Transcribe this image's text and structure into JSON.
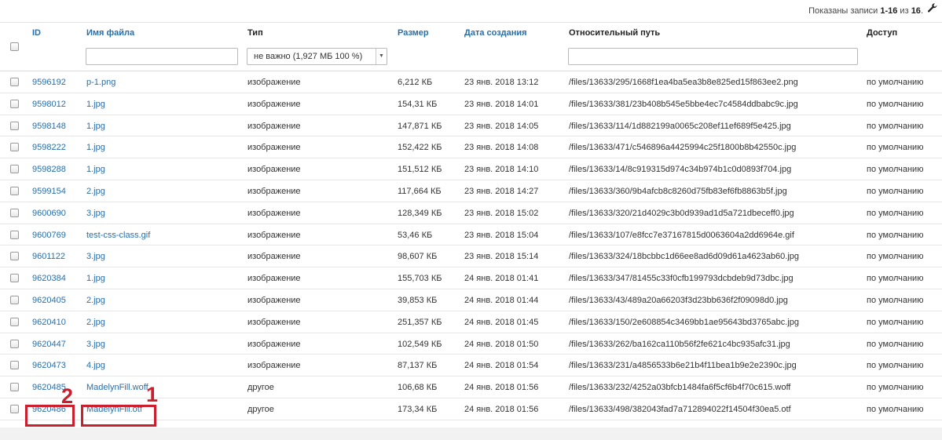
{
  "header": {
    "records_prefix": "Показаны записи ",
    "records_range": "1-16",
    "records_middle": " из ",
    "records_total": "16",
    "records_suffix": ".",
    "settings_icon": "wrench-icon"
  },
  "columns": {
    "id": "ID",
    "filename": "Имя файла",
    "type": "Тип",
    "size": "Размер",
    "created": "Дата создания",
    "path": "Относительный путь",
    "access": "Доступ"
  },
  "filters": {
    "filename_value": "",
    "type_selected": "не важно (1,927 МБ 100 %)",
    "path_value": ""
  },
  "rows": [
    {
      "id": "9596192",
      "name": "p-1.png",
      "type": "изображение",
      "size": "6,212 КБ",
      "date": "23 янв. 2018 13:12",
      "path": "/files/13633/295/1668f1ea4ba5ea3b8e825ed15f863ee2.png",
      "access": "по умолчанию"
    },
    {
      "id": "9598012",
      "name": "1.jpg",
      "type": "изображение",
      "size": "154,31 КБ",
      "date": "23 янв. 2018 14:01",
      "path": "/files/13633/381/23b408b545e5bbe4ec7c4584ddbabc9c.jpg",
      "access": "по умолчанию"
    },
    {
      "id": "9598148",
      "name": "1.jpg",
      "type": "изображение",
      "size": "147,871 КБ",
      "date": "23 янв. 2018 14:05",
      "path": "/files/13633/114/1d882199a0065c208ef11ef689f5e425.jpg",
      "access": "по умолчанию"
    },
    {
      "id": "9598222",
      "name": "1.jpg",
      "type": "изображение",
      "size": "152,422 КБ",
      "date": "23 янв. 2018 14:08",
      "path": "/files/13633/471/c546896a4425994c25f1800b8b42550c.jpg",
      "access": "по умолчанию"
    },
    {
      "id": "9598288",
      "name": "1.jpg",
      "type": "изображение",
      "size": "151,512 КБ",
      "date": "23 янв. 2018 14:10",
      "path": "/files/13633/14/8c919315d974c34b974b1c0d0893f704.jpg",
      "access": "по умолчанию"
    },
    {
      "id": "9599154",
      "name": "2.jpg",
      "type": "изображение",
      "size": "117,664 КБ",
      "date": "23 янв. 2018 14:27",
      "path": "/files/13633/360/9b4afcb8c8260d75fb83ef6fb8863b5f.jpg",
      "access": "по умолчанию"
    },
    {
      "id": "9600690",
      "name": "3.jpg",
      "type": "изображение",
      "size": "128,349 КБ",
      "date": "23 янв. 2018 15:02",
      "path": "/files/13633/320/21d4029c3b0d939ad1d5a721dbeceff0.jpg",
      "access": "по умолчанию"
    },
    {
      "id": "9600769",
      "name": "test-css-class.gif",
      "type": "изображение",
      "size": "53,46 КБ",
      "date": "23 янв. 2018 15:04",
      "path": "/files/13633/107/e8fcc7e37167815d0063604a2dd6964e.gif",
      "access": "по умолчанию"
    },
    {
      "id": "9601122",
      "name": "3.jpg",
      "type": "изображение",
      "size": "98,607 КБ",
      "date": "23 янв. 2018 15:14",
      "path": "/files/13633/324/18bcbbc1d66ee8ad6d09d61a4623ab60.jpg",
      "access": "по умолчанию"
    },
    {
      "id": "9620384",
      "name": "1.jpg",
      "type": "изображение",
      "size": "155,703 КБ",
      "date": "24 янв. 2018 01:41",
      "path": "/files/13633/347/81455c33f0cfb199793dcbdeb9d73dbc.jpg",
      "access": "по умолчанию"
    },
    {
      "id": "9620405",
      "name": "2.jpg",
      "type": "изображение",
      "size": "39,853 КБ",
      "date": "24 янв. 2018 01:44",
      "path": "/files/13633/43/489a20a66203f3d23bb636f2f09098d0.jpg",
      "access": "по умолчанию"
    },
    {
      "id": "9620410",
      "name": "2.jpg",
      "type": "изображение",
      "size": "251,357 КБ",
      "date": "24 янв. 2018 01:45",
      "path": "/files/13633/150/2e608854c3469bb1ae95643bd3765abc.jpg",
      "access": "по умолчанию"
    },
    {
      "id": "9620447",
      "name": "3.jpg",
      "type": "изображение",
      "size": "102,549 КБ",
      "date": "24 янв. 2018 01:50",
      "path": "/files/13633/262/ba162ca110b56f2fe621c4bc935afc31.jpg",
      "access": "по умолчанию"
    },
    {
      "id": "9620473",
      "name": "4.jpg",
      "type": "изображение",
      "size": "87,137 КБ",
      "date": "24 янв. 2018 01:54",
      "path": "/files/13633/231/a4856533b6e21b4f11bea1b9e2e2390c.jpg",
      "access": "по умолчанию"
    },
    {
      "id": "9620485",
      "name": "MadelynFill.woff",
      "type": "другое",
      "size": "106,68 КБ",
      "date": "24 янв. 2018 01:56",
      "path": "/files/13633/232/4252a03bfcb1484fa6f5cf6b4f70c615.woff",
      "access": "по умолчанию"
    },
    {
      "id": "9620486",
      "name": "MadelynFill.otf",
      "type": "другое",
      "size": "173,34 КБ",
      "date": "24 янв. 2018 01:56",
      "path": "/files/13633/498/382043fad7a712894022f14504f30ea5.otf",
      "access": "по умолчанию"
    }
  ],
  "annotations": {
    "label_1": "1",
    "label_2": "2",
    "color": "#cc1f2e"
  },
  "colors": {
    "link": "#2a6ea8",
    "text": "#333333"
  }
}
